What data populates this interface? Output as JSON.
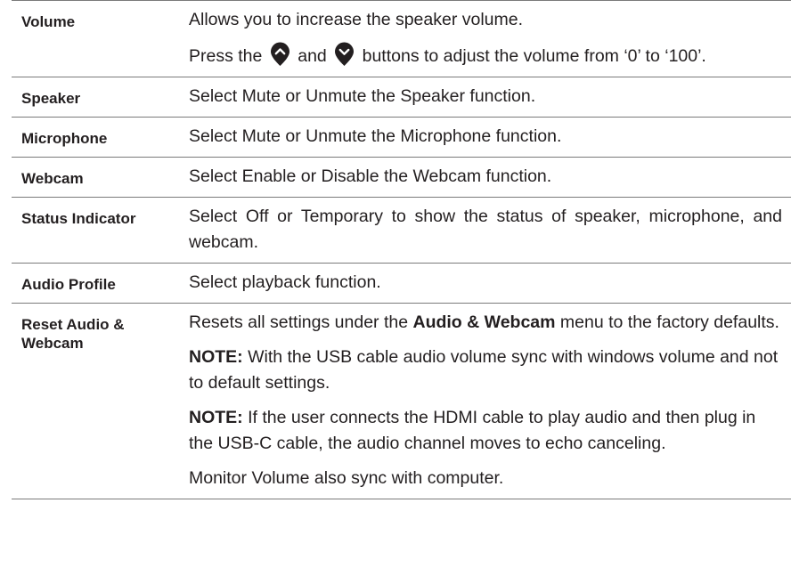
{
  "rows": [
    {
      "name": "Volume",
      "desc_1": "Allows you to increase the speaker volume.",
      "desc_2a": "Press the",
      "desc_2b": "and",
      "desc_2c": "buttons to adjust the volume from ‘0’ to ‘100’."
    },
    {
      "name": "Speaker",
      "desc": "Select Mute or Unmute the Speaker function."
    },
    {
      "name": "Microphone",
      "desc": "Select Mute or Unmute the Microphone function."
    },
    {
      "name": "Webcam",
      "desc": "Select Enable or Disable the Webcam function."
    },
    {
      "name": "Status Indicator",
      "desc": "Select Off or Temporary to show the status of speaker, microphone, and webcam."
    },
    {
      "name": "Audio Profile",
      "desc": "Select playback function."
    },
    {
      "name": "Reset Audio & Webcam",
      "desc_1a": "Resets all settings under the",
      "desc_1b": "Audio & Webcam",
      "desc_1c": "menu to the factory defaults.",
      "note_label": "NOTE:",
      "note_1": "With the USB cable audio volume sync with windows volume and not to default settings.",
      "note_2": "If the user connects the HDMI cable to play audio and then plug in the USB-C cable, the audio channel moves to echo canceling.",
      "desc_last": "Monitor Volume also sync with computer."
    }
  ],
  "icons": {
    "up": "arrow-up-button-icon",
    "down": "arrow-down-button-icon",
    "color": "#231f20"
  }
}
